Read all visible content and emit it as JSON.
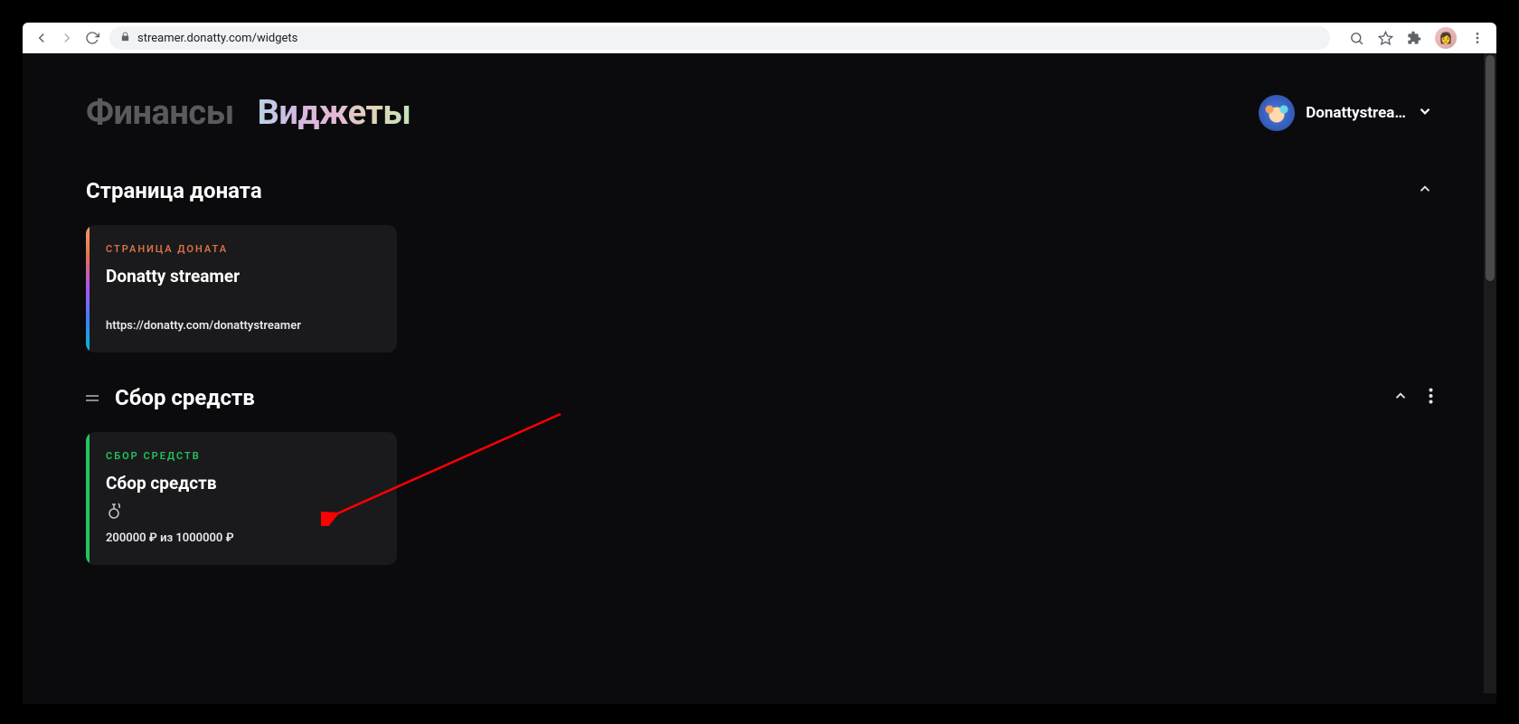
{
  "browser": {
    "url": "streamer.donatty.com/widgets"
  },
  "nav": {
    "tab_finance": "Финансы",
    "tab_widgets": "Виджеты"
  },
  "user": {
    "name": "Donattystrea…"
  },
  "section_donation": {
    "title": "Страница доната",
    "card": {
      "label": "СТРАНИЦА ДОНАТА",
      "title": "Donatty streamer",
      "url": "https://donatty.com/donattystreamer"
    }
  },
  "section_fundraising": {
    "title": "Сбор средств",
    "card": {
      "label": "СБОР СРЕДСТВ",
      "title": "Сбор средств",
      "goal_text": "200000 ₽ из 1000000 ₽"
    }
  }
}
